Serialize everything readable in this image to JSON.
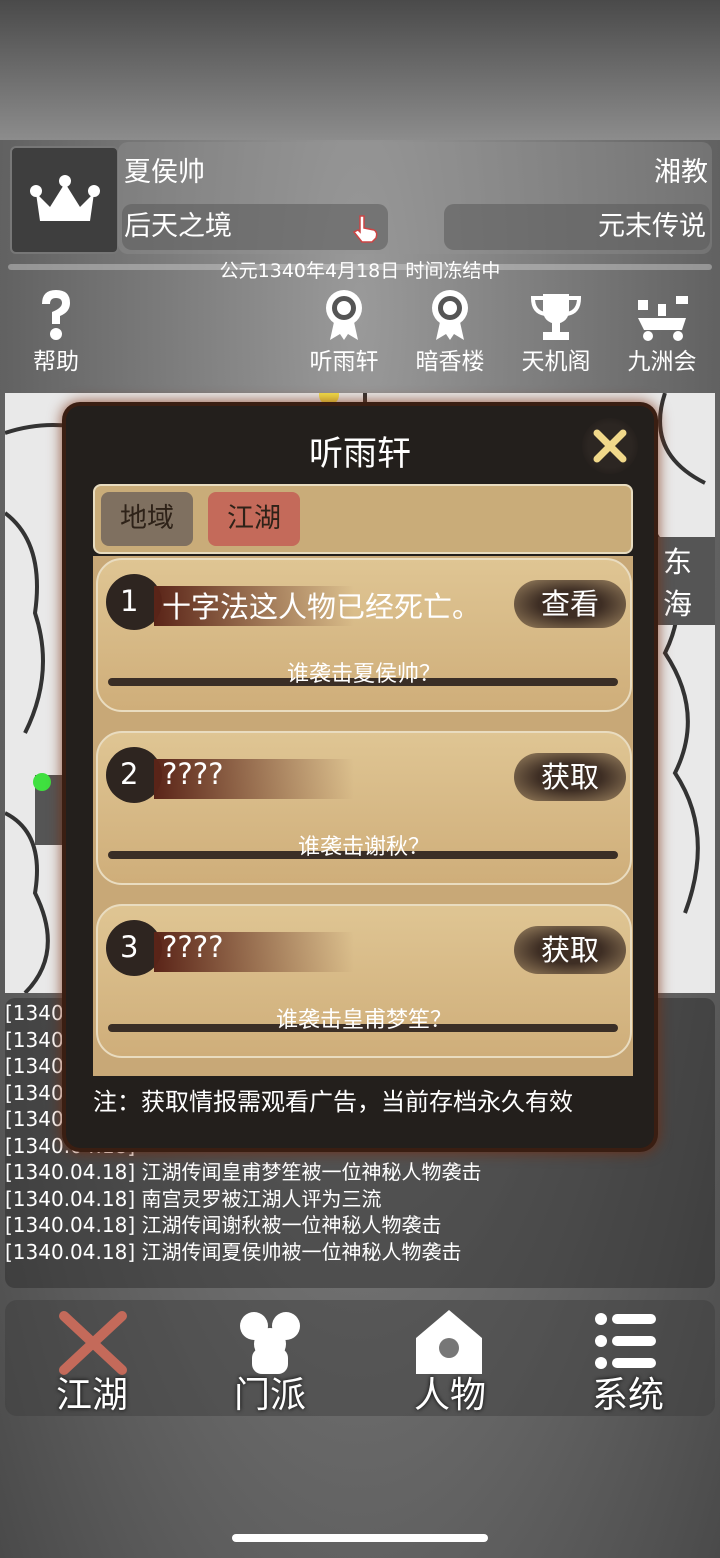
{
  "header": {
    "player_name": "夏侯帅",
    "sect": "湘教",
    "realm": "后天之境",
    "era_name": "元末传说",
    "date_status": "公元1340年4月18日 时间冻结中"
  },
  "menu": [
    {
      "label": "帮助",
      "icon": "question-icon"
    },
    {
      "label": "听雨轩",
      "icon": "medal-icon"
    },
    {
      "label": "暗香楼",
      "icon": "medal-icon"
    },
    {
      "label": "天机阁",
      "icon": "trophy-icon"
    },
    {
      "label": "九洲会",
      "icon": "cart-icon"
    }
  ],
  "map": {
    "region_label": "东海"
  },
  "log": [
    "[1340.0",
    "[1340.",
    "[1340.",
    "[1340.",
    "[1340.",
    "[1340.04.18]",
    "[1340.04.18] 江湖传闻皇甫梦笙被一位神秘人物袭击",
    "[1340.04.18] 南宫灵罗被江湖人评为三流",
    "[1340.04.18] 江湖传闻谢秋被一位神秘人物袭击",
    "[1340.04.18] 江湖传闻夏侯帅被一位神秘人物袭击"
  ],
  "modal": {
    "title": "听雨轩",
    "tabs": [
      "地域",
      "江湖"
    ],
    "cards": [
      {
        "num": "1",
        "title": "十字法这人物已经死亡。",
        "button": "查看",
        "question": "谁袭击夏侯帅？"
      },
      {
        "num": "2",
        "title": "????",
        "button": "获取",
        "question": "谁袭击谢秋？"
      },
      {
        "num": "3",
        "title": "????",
        "button": "获取",
        "question": "谁袭击皇甫梦笙？"
      }
    ],
    "note": "注：获取情报需观看广告，当前存档永久有效"
  },
  "bottom_nav": [
    {
      "label": "江湖",
      "icon": "crossed-swords-icon"
    },
    {
      "label": "门派",
      "icon": "sect-icon"
    },
    {
      "label": "人物",
      "icon": "person-icon"
    },
    {
      "label": "系统",
      "icon": "list-icon"
    }
  ],
  "colors": {
    "accent_red": "#c46a5a",
    "parchment": "#d4b888",
    "active_tab": "#c46a5a",
    "inactive_tab": "#7f7060"
  }
}
